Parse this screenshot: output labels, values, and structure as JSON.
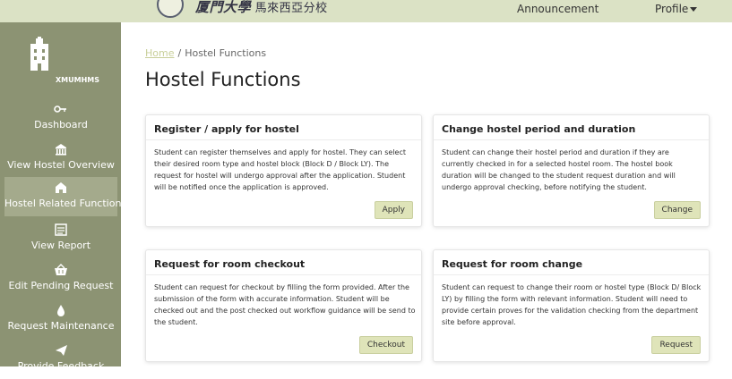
{
  "header": {
    "university_name_main": "厦門大學",
    "university_name_sub": "馬來西亞分校",
    "nav": {
      "announcement": "Announcement",
      "profile": "Profile"
    }
  },
  "sidebar": {
    "brand": "XMUMHMS",
    "items": [
      {
        "label": "Dashboard",
        "icon": "key-icon"
      },
      {
        "label": "View Hostel Overview",
        "icon": "building-icon"
      },
      {
        "label": "Hostel Related Functions",
        "icon": "home-icon",
        "active": true
      },
      {
        "label": "View Report",
        "icon": "report-icon"
      },
      {
        "label": "Edit Pending Request",
        "icon": "basket-icon"
      },
      {
        "label": "Request Maintenance",
        "icon": "drop-icon"
      },
      {
        "label": "Provide Feedback",
        "icon": "send-icon"
      }
    ]
  },
  "main": {
    "breadcrumb": {
      "home": "Home",
      "current": "Hostel Functions"
    },
    "title": "Hostel Functions",
    "cards": [
      {
        "title": "Register / apply for hostel",
        "body": "Student can register themselves and apply for hostel. They can select their desired room type and hostel block (Block D / Block LY). The request for hostel will undergo approval after the application. Student will be notified once the application is approved.",
        "button": "Apply"
      },
      {
        "title": "Change hostel period and duration",
        "body": "Student can change their hostel period and duration if they are currently checked in for a selected hostel room. The hostel book duration will be changed to the student request duration and will undergo approval checking, before notifying the student.",
        "button": "Change"
      },
      {
        "title": "Request for room checkout",
        "body": "Student can request for checkout by filling the form provided. After the submission of the form with accurate information. Student will be checked out and the post checked out workflow guidance will be send to the student.",
        "button": "Checkout"
      },
      {
        "title": "Request for room change",
        "body": "Student can request to change their room or hostel type (Block D/ Block LY) by filling the form with relevant information. Student will need to provide certain proves for the validation checking from the department site before approval.",
        "button": "Request"
      }
    ]
  },
  "colors": {
    "topbar": "#dbe2c5",
    "sidebar": "#8c9373",
    "sidebar_active": "#a4aa8c",
    "button": "#dfe4b9"
  }
}
